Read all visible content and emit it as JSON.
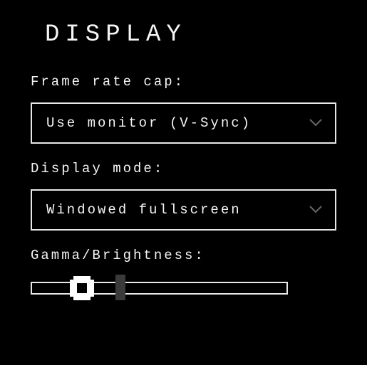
{
  "title": "DISPLAY",
  "frame_rate": {
    "label": "Frame rate cap:",
    "value": "Use monitor (V-Sync)"
  },
  "display_mode": {
    "label": "Display mode:",
    "value": "Windowed fullscreen"
  },
  "gamma": {
    "label": "Gamma/Brightness:",
    "value_percent": 20,
    "default_marker_percent": 35
  }
}
